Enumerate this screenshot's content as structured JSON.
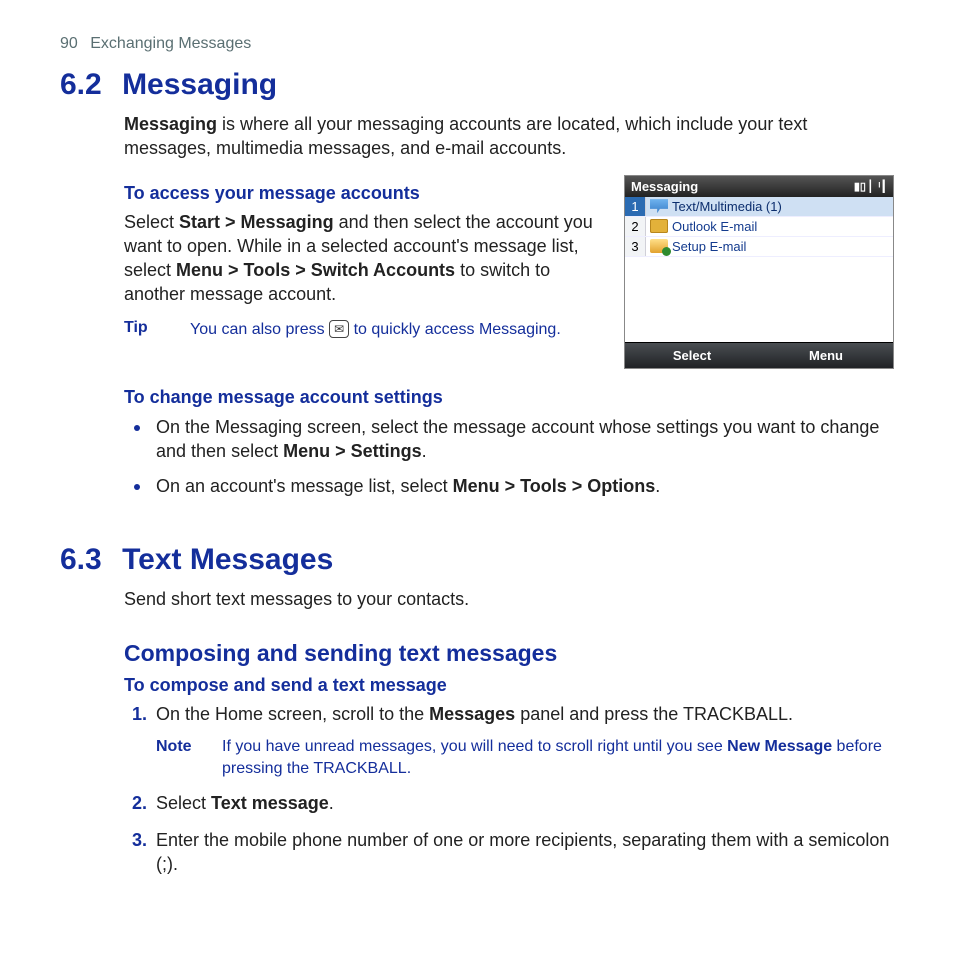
{
  "page_header": {
    "number": "90",
    "chapter": "Exchanging Messages"
  },
  "section_62": {
    "number": "6.2",
    "title": "Messaging",
    "intro_pre": "Messaging",
    "intro_post": " is where all your messaging accounts are located, which include your text messages, multimedia messages, and e-mail accounts.",
    "access_hdr": "To access your message accounts",
    "access_a": "Select ",
    "access_b": "Start > Messaging",
    "access_c": " and then select the account you want to open. While in a selected account's message list, select ",
    "access_d": "Menu > Tools > Switch Accounts",
    "access_e": " to switch to another message account.",
    "tip_label": "Tip",
    "tip_a": "You can also press ",
    "tip_b": " to quickly access Messaging.",
    "tip_key": "✉",
    "change_hdr": "To change message account settings",
    "bullet1_a": "On the Messaging screen, select the message account whose settings you want to change and then select ",
    "bullet1_b": "Menu > Settings",
    "bullet1_c": ".",
    "bullet2_a": "On an account's message list, select ",
    "bullet2_b": "Menu > Tools > Options",
    "bullet2_c": "."
  },
  "device": {
    "title": "Messaging",
    "soft_left": "Select",
    "soft_right": "Menu",
    "rows": [
      {
        "num": "1",
        "label": "Text/Multimedia (1)",
        "icon": "sms"
      },
      {
        "num": "2",
        "label": "Outlook E-mail",
        "icon": "outlook"
      },
      {
        "num": "3",
        "label": "Setup E-mail",
        "icon": "setup"
      }
    ]
  },
  "section_63": {
    "number": "6.3",
    "title": "Text Messages",
    "intro": "Send short text messages to your contacts.",
    "sub": "Composing and sending text messages",
    "compose_hdr": "To compose and send a text message",
    "step1_a": "On the Home screen, scroll to the ",
    "step1_b": "Messages",
    "step1_c": " panel and press the TRACKBALL.",
    "note_label": "Note",
    "note_a": "If you have unread messages, you will need to scroll right until you see ",
    "note_b": "New Message",
    "note_c": " before pressing the TRACKBALL.",
    "step2_a": "Select ",
    "step2_b": "Text message",
    "step2_c": ".",
    "step3": "Enter the mobile phone number of one or more recipients, separating them with a semicolon (;)."
  }
}
